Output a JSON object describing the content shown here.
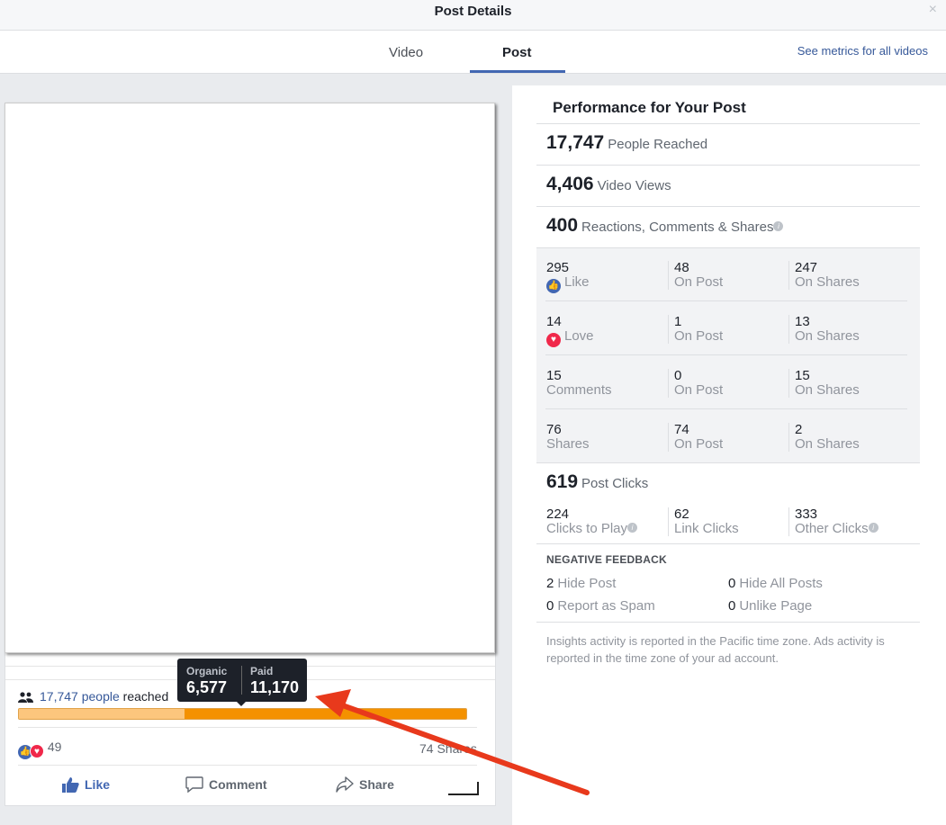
{
  "header": {
    "title": "Post Details",
    "close_glyph": "×"
  },
  "tabs": {
    "video": "Video",
    "post": "Post",
    "link": "See metrics for all videos"
  },
  "post": {
    "reach_count": "17,747 people",
    "reach_suffix": " reached",
    "organic_fraction": 0.37,
    "tooltip": {
      "organic_label": "Organic",
      "organic_value": "6,577",
      "paid_label": "Paid",
      "paid_value": "11,170"
    },
    "reactions_count": "49",
    "shares_text": "74 Shares",
    "actions": {
      "like": "Like",
      "comment": "Comment",
      "share": "Share"
    },
    "colors": {
      "organic": "#fcc67d",
      "paid": "#f49100",
      "accent": "#4267b2"
    }
  },
  "performance": {
    "title": "Performance for Your Post",
    "people_reached": {
      "num": "17,747",
      "label": "People Reached"
    },
    "video_views": {
      "num": "4,406",
      "label": "Video Views"
    },
    "engagement": {
      "num": "400",
      "label": "Reactions, Comments & Shares"
    },
    "breakdown": [
      {
        "total": "295",
        "label": "Like",
        "on_post": "48",
        "on_post_label": "On Post",
        "on_shares": "247",
        "on_shares_label": "On Shares"
      },
      {
        "total": "14",
        "label": "Love",
        "on_post": "1",
        "on_post_label": "On Post",
        "on_shares": "13",
        "on_shares_label": "On Shares"
      },
      {
        "total": "15",
        "label": "Comments",
        "on_post": "0",
        "on_post_label": "On Post",
        "on_shares": "15",
        "on_shares_label": "On Shares"
      },
      {
        "total": "76",
        "label": "Shares",
        "on_post": "74",
        "on_post_label": "On Post",
        "on_shares": "2",
        "on_shares_label": "On Shares"
      }
    ],
    "post_clicks": {
      "num": "619",
      "label": "Post Clicks"
    },
    "clicks": [
      {
        "num": "224",
        "label": "Clicks to Play"
      },
      {
        "num": "62",
        "label": "Link Clicks"
      },
      {
        "num": "333",
        "label": "Other Clicks"
      }
    ],
    "negative_feedback": {
      "title": "NEGATIVE FEEDBACK",
      "hide_post": {
        "num": "2",
        "label": "Hide Post"
      },
      "hide_all": {
        "num": "0",
        "label": "Hide All Posts"
      },
      "spam": {
        "num": "0",
        "label": "Report as Spam"
      },
      "unlike": {
        "num": "0",
        "label": "Unlike Page"
      }
    },
    "footnote": "Insights activity is reported in the Pacific time zone. Ads activity is reported in the time zone of your ad account."
  }
}
